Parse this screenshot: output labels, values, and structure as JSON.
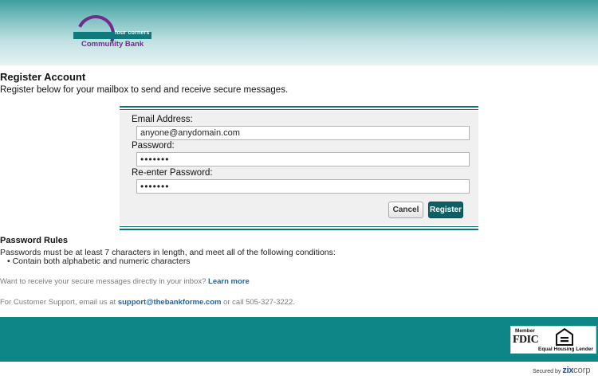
{
  "header": {
    "logo_tag": "four corners",
    "logo_name": "Community Bank"
  },
  "page": {
    "title": "Register Account",
    "subtitle": "Register below for your mailbox to send and receive secure messages."
  },
  "form": {
    "email_label": "Email Address:",
    "email_value": "anyone@anydomain.com",
    "password_label": "Password:",
    "password_value": "•••••••",
    "reenter_label": "Re-enter Password:",
    "reenter_value": "•••••••",
    "cancel_label": "Cancel",
    "register_label": "Register"
  },
  "rules": {
    "title": "Password Rules",
    "text": "Passwords must be at least 7 characters in length, and meet all of the following conditions:",
    "bullets": [
      "•  Contain both alphabetic and numeric characters"
    ]
  },
  "inbox": {
    "text": "Want to receive your secure messages directly in your inbox?",
    "link": "Learn more"
  },
  "support": {
    "prefix": "For Customer Support, email us at",
    "email": "support@thebankforme.com",
    "suffix": "or call 505-327-3222."
  },
  "footer": {
    "member": "Member",
    "fdic": "FDIC",
    "equal_housing": "Equal Housing Lender",
    "secured_by": "Secured by",
    "zix": "zix",
    "corp": "corp"
  },
  "colors": {
    "brand_teal": "#0e8688",
    "brand_purple": "#6f2c8e",
    "button_dark": "#0e5f63",
    "link_blue": "#1f64a8"
  }
}
